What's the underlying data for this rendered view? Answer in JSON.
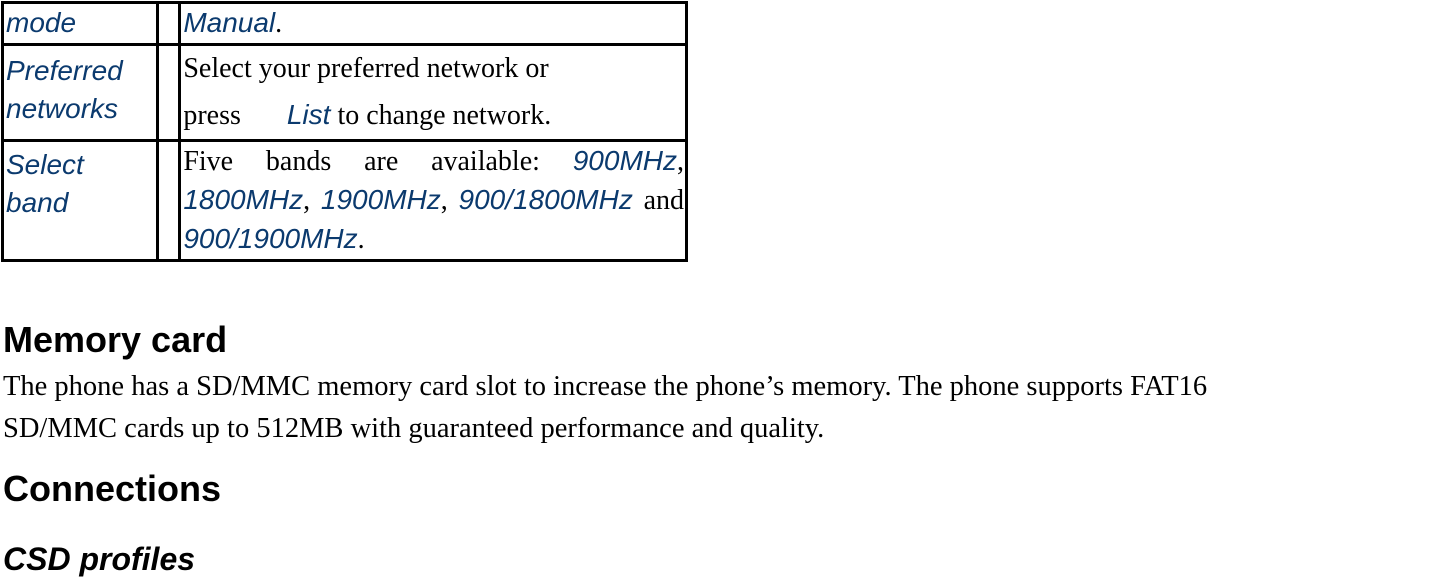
{
  "table": {
    "rows": [
      {
        "term": "mode",
        "desc_parts": [
          {
            "text": "Manual",
            "style": "option"
          },
          {
            "text": ".",
            "style": "plain"
          }
        ]
      },
      {
        "term_lines": [
          "Preferred",
          "networks"
        ],
        "desc_line1": "Select your preferred network or",
        "desc_line2_prefix": "press",
        "desc_line2_option": "List",
        "desc_line2_suffix": " to change network."
      },
      {
        "term_lines": [
          "Select",
          "band"
        ],
        "desc_intro": "Five bands are available: ",
        "bands": [
          "900MHz",
          "1800MHz",
          "1900MHz",
          "900/1800MHz",
          "900/1900MHz"
        ],
        "comma": ",",
        "and": " and ",
        "period": "."
      }
    ]
  },
  "sections": {
    "memory_card": {
      "heading": "Memory card",
      "line1": "The phone has a SD/MMC memory card slot to increase the phone’s memory. The phone supports FAT16",
      "line2": "SD/MMC cards up to 512MB with guaranteed performance and quality."
    },
    "connections": {
      "heading": "Connections",
      "subheading": "CSD profiles"
    }
  },
  "colors": {
    "option_text": "#0b3a6e",
    "body_text": "#000000",
    "border": "#000000"
  }
}
